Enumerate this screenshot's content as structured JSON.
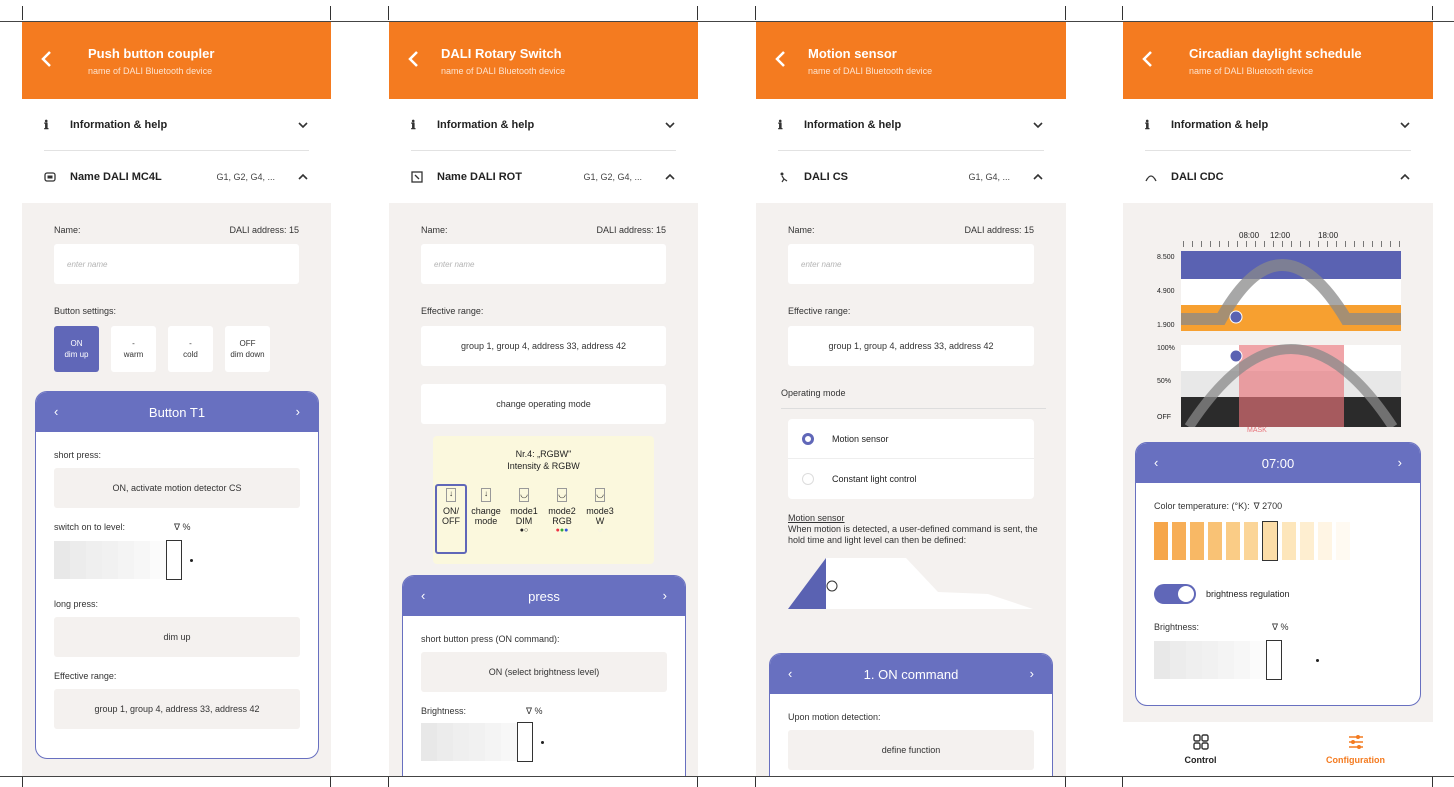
{
  "screens": [
    {
      "title": "Push button coupler",
      "subtitle": "name of DALI Bluetooth device",
      "info_label": "Information & help",
      "device_name": "Name DALI MC4L",
      "device_groups": "G1, G2, G4, ...",
      "name_label": "Name:",
      "dali_address": "DALI address: 15",
      "name_placeholder": "enter name",
      "button_settings_label": "Button settings:",
      "buttons": [
        {
          "top": "ON",
          "bottom": "dim up"
        },
        {
          "top": "-",
          "bottom": "warm"
        },
        {
          "top": "-",
          "bottom": "cold"
        },
        {
          "top": "OFF",
          "bottom": "dim down"
        }
      ],
      "card_title": "Button T1",
      "short_press_label": "short press:",
      "short_press_value": "ON, activate motion detector CS",
      "switch_level_label": "switch on to level:",
      "switch_level_unit": "∇ %",
      "long_press_label": "long press:",
      "long_press_value": "dim up",
      "effective_range_label": "Effective range:",
      "effective_range_value": "group 1, group 4, address 33, address 42"
    },
    {
      "title": "DALI Rotary Switch",
      "subtitle": "name of DALI Bluetooth device",
      "info_label": "Information & help",
      "device_name": "Name DALI ROT",
      "device_groups": "G1, G2, G4, ...",
      "name_label": "Name:",
      "dali_address": "DALI address: 15",
      "name_placeholder": "enter name",
      "effective_range_label": "Effective range:",
      "effective_range_value": "group 1, group 4, address 33, address 42",
      "mode_button": "change operating mode",
      "mode_title_1": "Nr.4: „RGBW\"",
      "mode_title_2": "Intensity & RGBW",
      "modes": [
        {
          "l1": "ON/",
          "l2": "OFF"
        },
        {
          "l1": "change",
          "l2": "mode"
        },
        {
          "l1": "mode1",
          "l2": "DIM"
        },
        {
          "l1": "mode2",
          "l2": "RGB"
        },
        {
          "l1": "mode3",
          "l2": "W"
        }
      ],
      "card_title": "press",
      "short_press_label": "short button press (ON command):",
      "short_press_value": "ON (select brightness level)",
      "brightness_label": "Brightness:",
      "brightness_unit": "∇ %"
    },
    {
      "title": "Motion sensor",
      "subtitle": "name of DALI Bluetooth device",
      "info_label": "Information & help",
      "device_name": "DALI CS",
      "device_groups": "G1, G4, ...",
      "name_label": "Name:",
      "dali_address": "DALI address: 15",
      "name_placeholder": "enter name",
      "effective_range_label": "Effective range:",
      "effective_range_value": "group 1, group 4, address 33, address 42",
      "operating_mode_label": "Operating mode",
      "option_1": "Motion sensor",
      "option_2": "Constant light control",
      "desc_title": "Motion sensor",
      "desc_text": "When motion is detected, a user-defined command is sent, the hold time and light level can then be defined:",
      "card_title": "1. ON command",
      "upon_label": "Upon motion detection:",
      "define_function": "define function"
    },
    {
      "title": "Circadian daylight schedule",
      "subtitle": "name of DALI Bluetooth device",
      "info_label": "Information & help",
      "device_name": "DALI CDC",
      "times": [
        "08:00",
        "12:00",
        "18:00"
      ],
      "y_labels_top": [
        "8.500",
        "4.900",
        "1.900"
      ],
      "y_labels_bottom": [
        "100%",
        "50%",
        "OFF"
      ],
      "mask_label": "MASK",
      "card_title": "07:00",
      "color_temp_label": "Color temperature: (°K):",
      "color_temp_value": "∇  2700",
      "brightness_regulation": "brightness regulation",
      "brightness_label": "Brightness:",
      "brightness_unit": "∇ %",
      "tab_control": "Control",
      "tab_configuration": "Configuration"
    }
  ],
  "colors": {
    "orange": "#f47b20",
    "purple": "#6870c0",
    "background": "#f4f1ef"
  }
}
